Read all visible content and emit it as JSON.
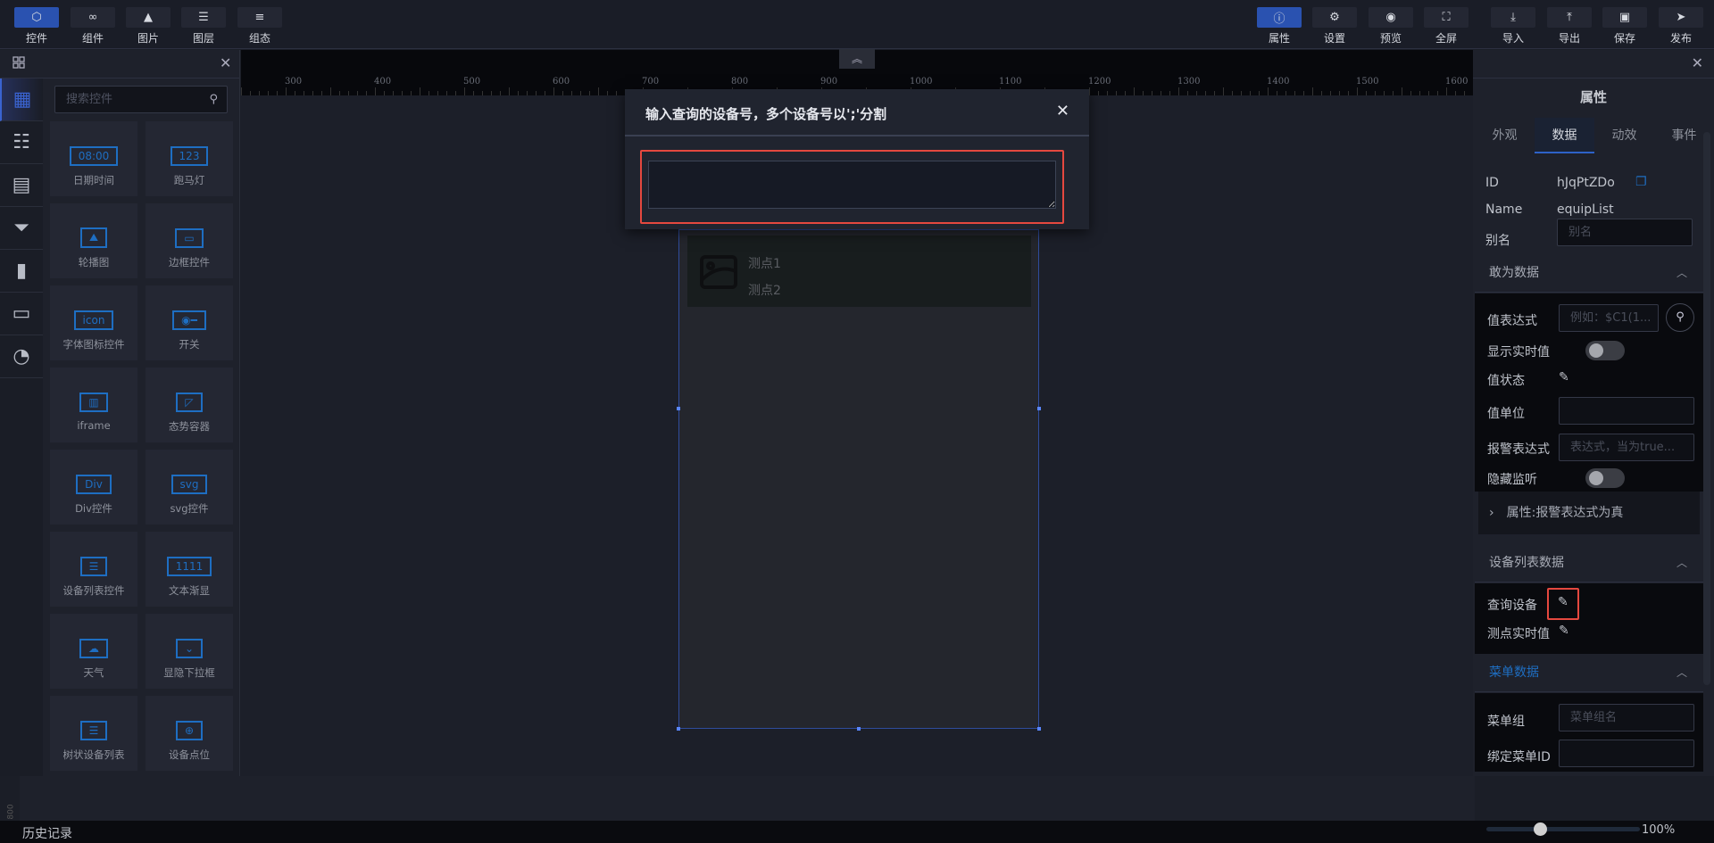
{
  "toolbar": {
    "left": [
      {
        "label": "控件",
        "icon": "cube-icon",
        "active": true
      },
      {
        "label": "组件",
        "icon": "link-icon"
      },
      {
        "label": "图片",
        "icon": "image-icon"
      },
      {
        "label": "图层",
        "icon": "layers-icon"
      },
      {
        "label": "组态",
        "icon": "align-icon"
      }
    ],
    "right": [
      {
        "label": "属性",
        "icon": "info-icon",
        "active": true
      },
      {
        "label": "设置",
        "icon": "gear-icon"
      },
      {
        "label": "预览",
        "icon": "eye-icon"
      },
      {
        "label": "全屏",
        "icon": "fullscreen-icon"
      },
      {
        "label": "导入",
        "icon": "import-icon"
      },
      {
        "label": "导出",
        "icon": "export-icon"
      },
      {
        "label": "保存",
        "icon": "save-icon"
      },
      {
        "label": "发布",
        "icon": "send-icon"
      }
    ]
  },
  "left_panel": {
    "search_placeholder": "搜索控件",
    "categories": [
      "grid-icon",
      "sliders-icon",
      "table-icon",
      "filter-icon",
      "bar-chart-icon",
      "video-icon",
      "pie-chart-icon"
    ],
    "widgets": [
      "日期时间",
      "跑马灯",
      "轮播图",
      "边框控件",
      "字体图标控件",
      "开关",
      "iframe",
      "态势容器",
      "Div控件",
      "svg控件",
      "设备列表控件",
      "文本渐显",
      "天气",
      "显隐下拉框",
      "树状设备列表",
      "设备点位"
    ]
  },
  "ruler": {
    "labels": [
      "300",
      "400",
      "500",
      "600",
      "700",
      "800",
      "900",
      "1000",
      "1100",
      "1200",
      "1300",
      "1400",
      "1500",
      "1600"
    ],
    "vertical_label": "800"
  },
  "component": {
    "items": [
      "测点1",
      "测点2"
    ]
  },
  "modal": {
    "title": "输入查询的设备号，多个设备号以';'分割",
    "value": ""
  },
  "right_panel": {
    "title": "属性",
    "tabs": [
      "外观",
      "数据",
      "动效",
      "事件"
    ],
    "active_tab": "数据",
    "id_label": "ID",
    "id_value": "hJqPtZDo",
    "name_label": "Name",
    "name_value": "equipList",
    "alias_label": "别名",
    "alias_placeholder": "别名",
    "section1": {
      "title": "敢为数据",
      "value_expr_label": "值表达式",
      "value_expr_placeholder": "例如：$C1(1...",
      "show_realtime_label": "显示实时值",
      "show_realtime": false,
      "value_state_label": "值状态",
      "value_unit_label": "值单位",
      "alarm_expr_label": "报警表达式",
      "alarm_expr_placeholder": "表达式，当为true...",
      "hide_listen_label": "隐藏监听",
      "hide_listen": false,
      "collapse_label": "属性:报警表达式为真"
    },
    "section2": {
      "title": "设备列表数据",
      "query_label": "查询设备",
      "point_label": "测点实时值"
    },
    "section3": {
      "title": "菜单数据",
      "menu_group_label": "菜单组",
      "menu_group_placeholder": "菜单组名",
      "menu_id_label": "绑定菜单ID"
    }
  },
  "footer": {
    "history_label": "历史记录",
    "zoom_value": "100%",
    "zoom_fraction": 0.35
  },
  "colors": {
    "accent": "#2a52b0",
    "highlight": "#e5483f",
    "menu_section": "#1e6ec2"
  }
}
